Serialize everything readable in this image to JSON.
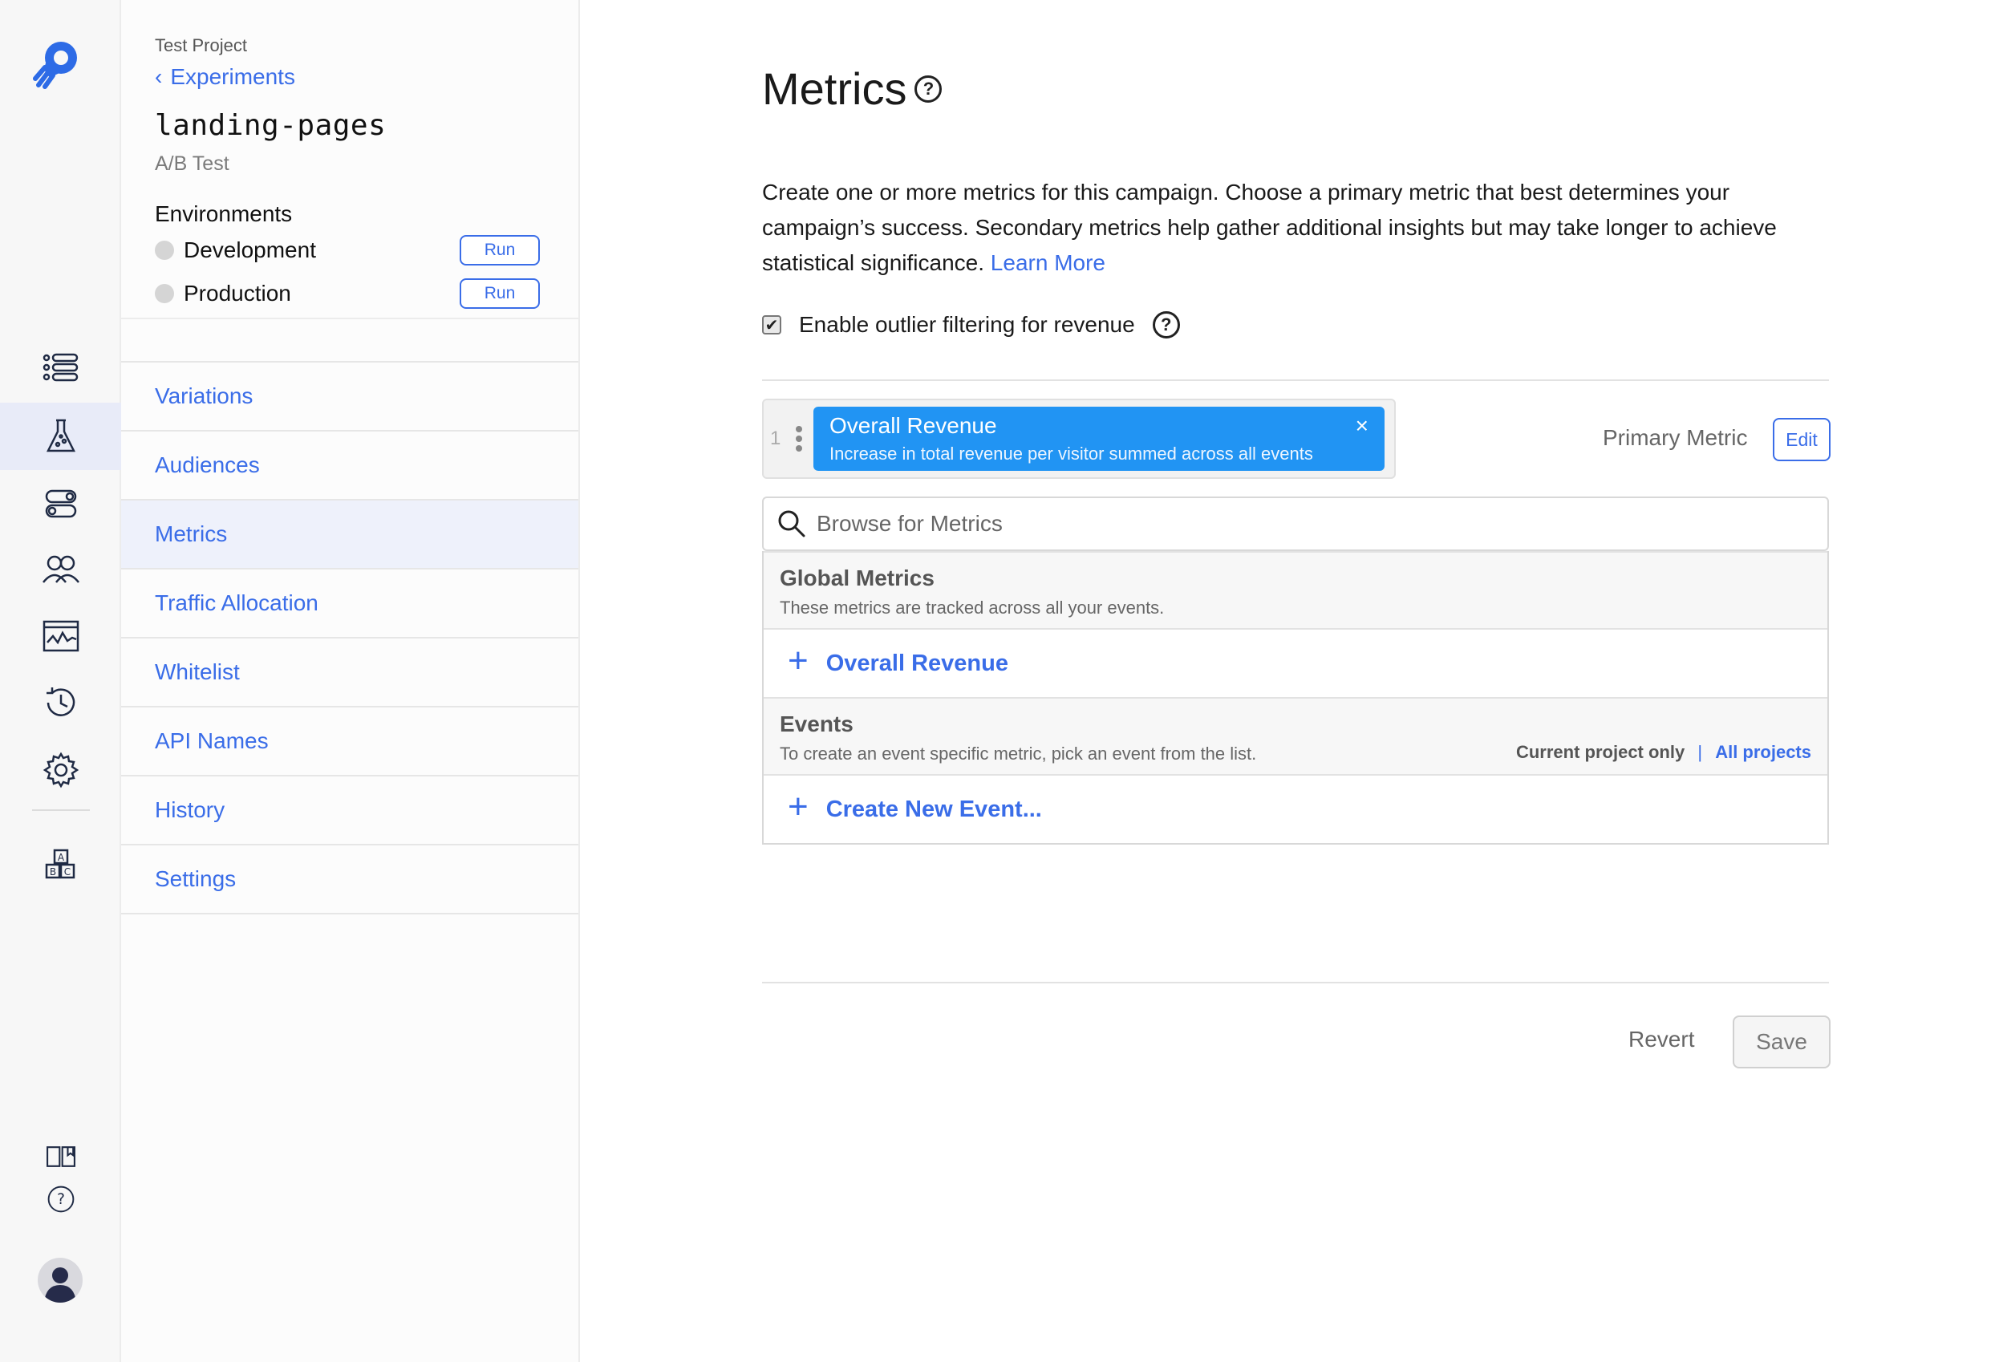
{
  "sidebar": {
    "project": "Test Project",
    "back_label": "Experiments",
    "experiment_name": "landing-pages",
    "experiment_type": "A/B Test",
    "environments_heading": "Environments",
    "environments": [
      {
        "name": "Development",
        "action": "Run"
      },
      {
        "name": "Production",
        "action": "Run"
      }
    ],
    "nav": [
      {
        "label": "Variations"
      },
      {
        "label": "Audiences"
      },
      {
        "label": "Metrics",
        "active": true
      },
      {
        "label": "Traffic Allocation"
      },
      {
        "label": "Whitelist"
      },
      {
        "label": "API Names"
      },
      {
        "label": "History"
      },
      {
        "label": "Settings"
      }
    ]
  },
  "rail": {
    "icons": [
      "list-icon",
      "flask-icon",
      "toggles-icon",
      "audiences-icon",
      "chart-icon",
      "history-icon",
      "gear-icon",
      "abc-blocks-icon",
      "book-icon",
      "help-icon"
    ],
    "active": "flask-icon",
    "accent": "#3a6de8"
  },
  "main": {
    "title": "Metrics",
    "help_glyph": "?",
    "description": "Create one or more metrics for this campaign. Choose a primary metric that best determines your campaign’s success. Secondary metrics help gather additional insights but may take longer to achieve statistical significance.",
    "learn_more": "Learn More",
    "outlier_label": "Enable outlier filtering for revenue",
    "outlier_checked": true,
    "primary_metric": {
      "index": "1",
      "title": "Overall Revenue",
      "subtitle": "Increase in total revenue per visitor summed across all events",
      "close": "×",
      "label": "Primary Metric",
      "edit": "Edit",
      "color": "#2194f3"
    },
    "search_placeholder": "Browse for Metrics",
    "global_metrics": {
      "title": "Global Metrics",
      "subtitle": "These metrics are tracked across all your events.",
      "items": [
        {
          "label": "Overall Revenue"
        }
      ]
    },
    "events": {
      "title": "Events",
      "subtitle": "To create an event specific metric, pick an event from the list.",
      "scope_current": "Current project only",
      "scope_sep": "|",
      "scope_all": "All projects",
      "create_label": "Create New Event..."
    },
    "revert": "Revert",
    "save": "Save"
  }
}
